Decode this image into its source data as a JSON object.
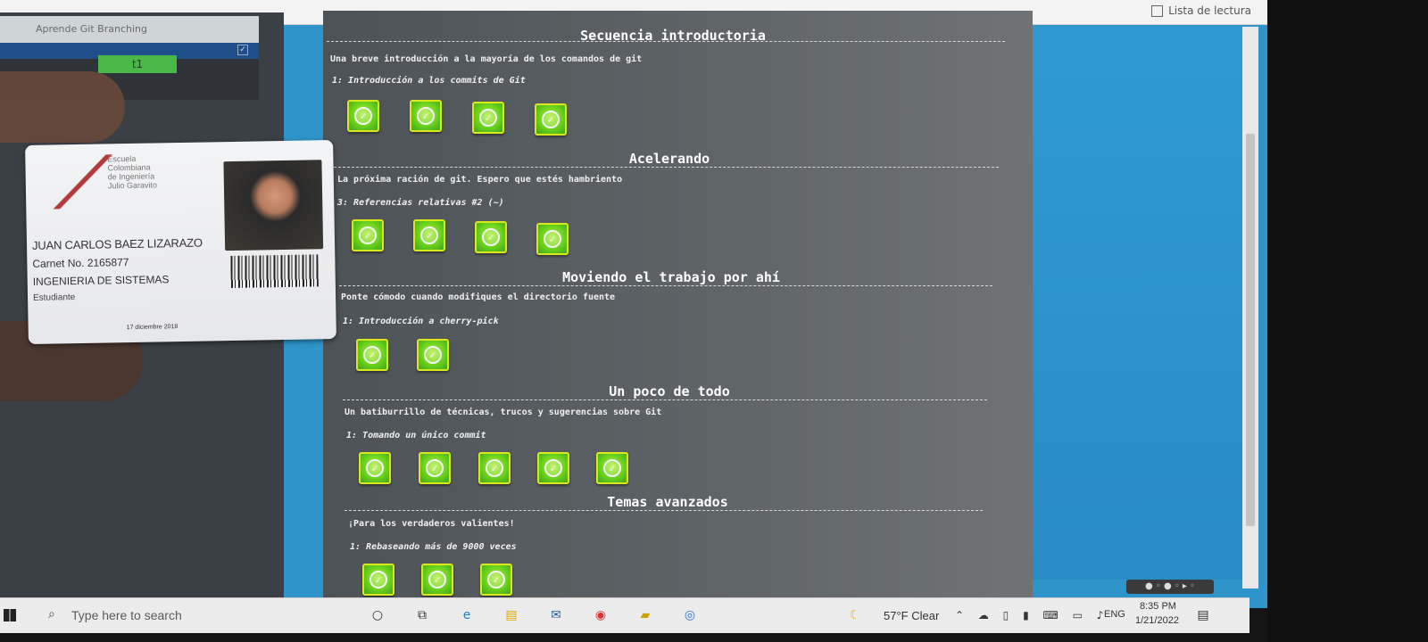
{
  "browser": {
    "reading_list_label": "Lista de lectura"
  },
  "left_panel": {
    "title": "Aprende Git Branching",
    "green_badge": "t1"
  },
  "sections": [
    {
      "title": "Secuencia introductoria",
      "description": "Una breve introducción a la mayoría de los comandos de git",
      "lesson": "1: Introducción a los commits de Git",
      "level_count": 4
    },
    {
      "title": "Acelerando",
      "description": "La próxima ración de git. Espero que estés hambriento",
      "lesson": "3: Referencias relativas #2 (~)",
      "level_count": 4
    },
    {
      "title": "Moviendo el trabajo por ahí",
      "description": "Ponte cómodo cuando modifiques el directorio fuente",
      "lesson": "1: Introducción a cherry-pick",
      "level_count": 2
    },
    {
      "title": "Un poco de todo",
      "description": "Un batiburrillo de técnicas, trucos y sugerencias sobre Git",
      "lesson": "1: Tomando un único commit",
      "level_count": 5
    },
    {
      "title": "Temas avanzados",
      "description": "¡Para los verdaderos valientes!",
      "lesson": "1: Rebaseando más de 9000 veces",
      "level_count": 3
    }
  ],
  "id_card": {
    "school_line1": "Escuela",
    "school_line2": "Colombiana",
    "school_line3": "de Ingeniería",
    "school_line4": "Julio Garavito",
    "name": "JUAN CARLOS BAEZ LIZARAZO",
    "carnet": "Carnet No. 2165877",
    "career": "INGENIERIA DE SISTEMAS",
    "role": "Estudiante",
    "date": "17 diciembre 2018"
  },
  "taskbar": {
    "search_placeholder": "Type here to search",
    "weather": "57°F  Clear",
    "language": "ENG",
    "time": "8:35 PM",
    "date": "1/21/2022"
  },
  "colors": {
    "level_green": "#6ad21c",
    "desktop_blue": "#2f94c9",
    "panel_gray": "#5a5f62"
  },
  "icons": {
    "level_complete": "check-circle-icon",
    "search": "search-icon",
    "windows": "windows-start-icon"
  }
}
